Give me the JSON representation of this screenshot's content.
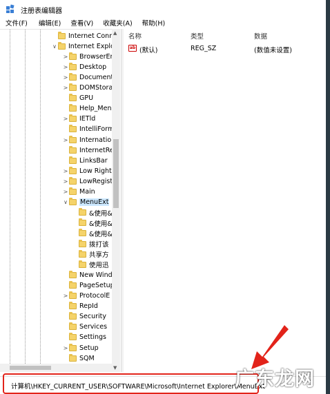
{
  "window": {
    "title": "注册表编辑器"
  },
  "menu": [
    "文件(F)",
    "编辑(E)",
    "查看(V)",
    "收藏夹(A)",
    "帮助(H)"
  ],
  "tree": [
    {
      "label": "Internet Conn",
      "chev": "",
      "indent": 1
    },
    {
      "label": "Internet Explo",
      "chev": "∨",
      "indent": 1
    },
    {
      "label": "BrowserEm",
      "chev": ">",
      "indent": 2
    },
    {
      "label": "Desktop",
      "chev": ">",
      "indent": 2
    },
    {
      "label": "Document",
      "chev": ">",
      "indent": 2
    },
    {
      "label": "DOMStora",
      "chev": ">",
      "indent": 2
    },
    {
      "label": "GPU",
      "chev": "",
      "indent": 2
    },
    {
      "label": "Help_Menu",
      "chev": "",
      "indent": 2
    },
    {
      "label": "IETld",
      "chev": ">",
      "indent": 2
    },
    {
      "label": "IntelliForm",
      "chev": "",
      "indent": 2
    },
    {
      "label": "Internatio",
      "chev": ">",
      "indent": 2
    },
    {
      "label": "InternetRe",
      "chev": "",
      "indent": 2
    },
    {
      "label": "LinksBar",
      "chev": "",
      "indent": 2
    },
    {
      "label": "Low Right",
      "chev": ">",
      "indent": 2
    },
    {
      "label": "LowRegist",
      "chev": ">",
      "indent": 2
    },
    {
      "label": "Main",
      "chev": ">",
      "indent": 2
    },
    {
      "label": "MenuExt",
      "chev": "∨",
      "indent": 2,
      "selected": true
    },
    {
      "label": "&使用&",
      "chev": "",
      "indent": 3
    },
    {
      "label": "&使用&",
      "chev": "",
      "indent": 3
    },
    {
      "label": "&使用&",
      "chev": "",
      "indent": 3
    },
    {
      "label": "拨打该",
      "chev": "",
      "indent": 3
    },
    {
      "label": "共享方",
      "chev": "",
      "indent": 3
    },
    {
      "label": "使用迅",
      "chev": "",
      "indent": 3
    },
    {
      "label": "New Wind",
      "chev": "",
      "indent": 2
    },
    {
      "label": "PageSetup",
      "chev": "",
      "indent": 2
    },
    {
      "label": "ProtocolE",
      "chev": ">",
      "indent": 2
    },
    {
      "label": "RepId",
      "chev": "",
      "indent": 2
    },
    {
      "label": "Security",
      "chev": "",
      "indent": 2
    },
    {
      "label": "Services",
      "chev": "",
      "indent": 2
    },
    {
      "label": "Settings",
      "chev": "",
      "indent": 2
    },
    {
      "label": "Setup",
      "chev": ">",
      "indent": 2
    },
    {
      "label": "SQM",
      "chev": "",
      "indent": 2
    }
  ],
  "columns": {
    "name": "名称",
    "type": "类型",
    "data": "数据"
  },
  "values": [
    {
      "name": "(默认)",
      "type": "REG_SZ",
      "data": "(数值未设置)"
    }
  ],
  "status_path": "计算机\\HKEY_CURRENT_USER\\SOFTWARE\\Microsoft\\Internet Explorer\\MenuExt",
  "watermark": "广东龙网",
  "colors": {
    "highlight": "#e2231a",
    "selected_bg": "#cce8ff",
    "folder": "#f5d36a"
  }
}
